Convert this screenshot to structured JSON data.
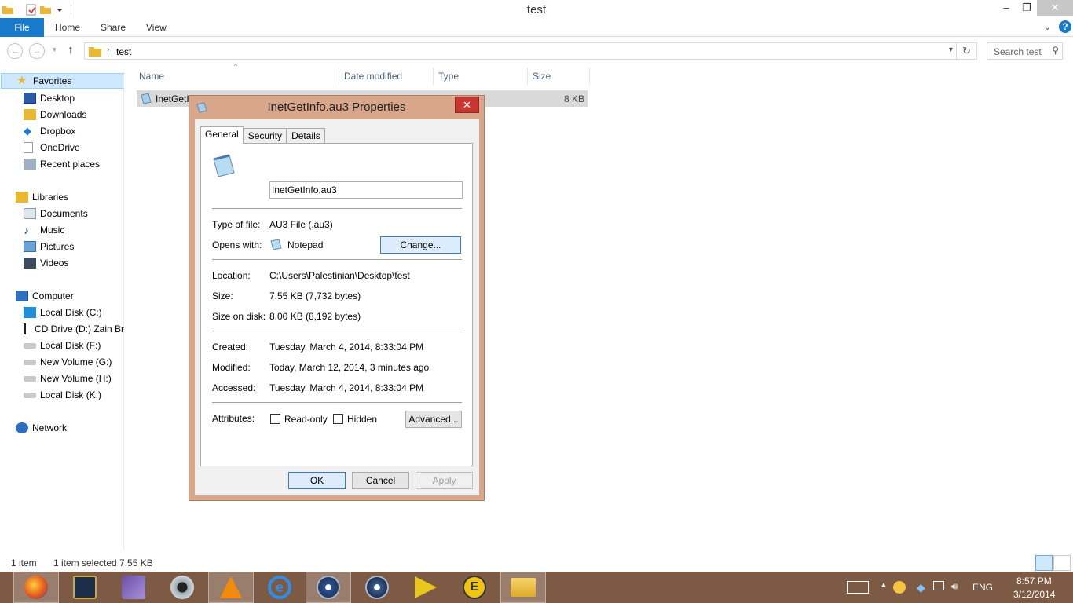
{
  "window": {
    "title": "test",
    "minimize": "–",
    "maximize": "❐",
    "close": "✕"
  },
  "ribbon": {
    "tabs": [
      "File",
      "Home",
      "Share",
      "View"
    ]
  },
  "address": {
    "path": "test",
    "search_placeholder": "Search test"
  },
  "navpane": {
    "favorites_header": "Favorites",
    "favorites": [
      "Desktop",
      "Downloads",
      "Dropbox",
      "OneDrive",
      "Recent places"
    ],
    "libraries_header": "Libraries",
    "libraries": [
      "Documents",
      "Music",
      "Pictures",
      "Videos"
    ],
    "computer_header": "Computer",
    "drives": [
      "Local Disk (C:)",
      "CD Drive (D:) Zain Br",
      "Local Disk (F:)",
      "New Volume (G:)",
      "New Volume (H:)",
      "Local Disk (K:)"
    ],
    "network_header": "Network"
  },
  "filelist": {
    "columns": [
      "Name",
      "Date modified",
      "Type",
      "Size"
    ],
    "rows": [
      {
        "name": "InetGetInfo.au3",
        "size": "8 KB"
      }
    ]
  },
  "statusbar": {
    "count": "1 item",
    "selected": "1 item selected  7.55 KB"
  },
  "dialog": {
    "title": "InetGetInfo.au3 Properties",
    "close": "✕",
    "tabs": [
      "General",
      "Security",
      "Details"
    ],
    "filename": "InetGetInfo.au3",
    "type_label": "Type of file:",
    "type_value": "AU3 File (.au3)",
    "opens_label": "Opens with:",
    "opens_value": "Notepad",
    "change_button": "Change...",
    "location_label": "Location:",
    "location_value": "C:\\Users\\Palestinian\\Desktop\\test",
    "size_label": "Size:",
    "size_value": "7.55 KB (7,732 bytes)",
    "size_disk_label": "Size on disk:",
    "size_disk_value": "8.00 KB (8,192 bytes)",
    "created_label": "Created:",
    "created_value": "Tuesday, March 4, 2014, 8:33:04 PM",
    "modified_label": "Modified:",
    "modified_value": "Today, March 12, 2014, 3 minutes ago",
    "accessed_label": "Accessed:",
    "accessed_value": "Tuesday, March 4, 2014, 8:33:04 PM",
    "attributes_label": "Attributes:",
    "readonly_label": "Read-only",
    "hidden_label": "Hidden",
    "advanced_button": "Advanced...",
    "ok_button": "OK",
    "cancel_button": "Cancel",
    "apply_button": "Apply"
  },
  "tray": {
    "language": "ENG",
    "time": "8:57 PM",
    "date": "3/12/2014"
  },
  "colors": {
    "accent": "#1979ca",
    "taskbar": "#7d5a44",
    "dialog_frame": "#d8a68a",
    "selection": "#cde8ff"
  }
}
